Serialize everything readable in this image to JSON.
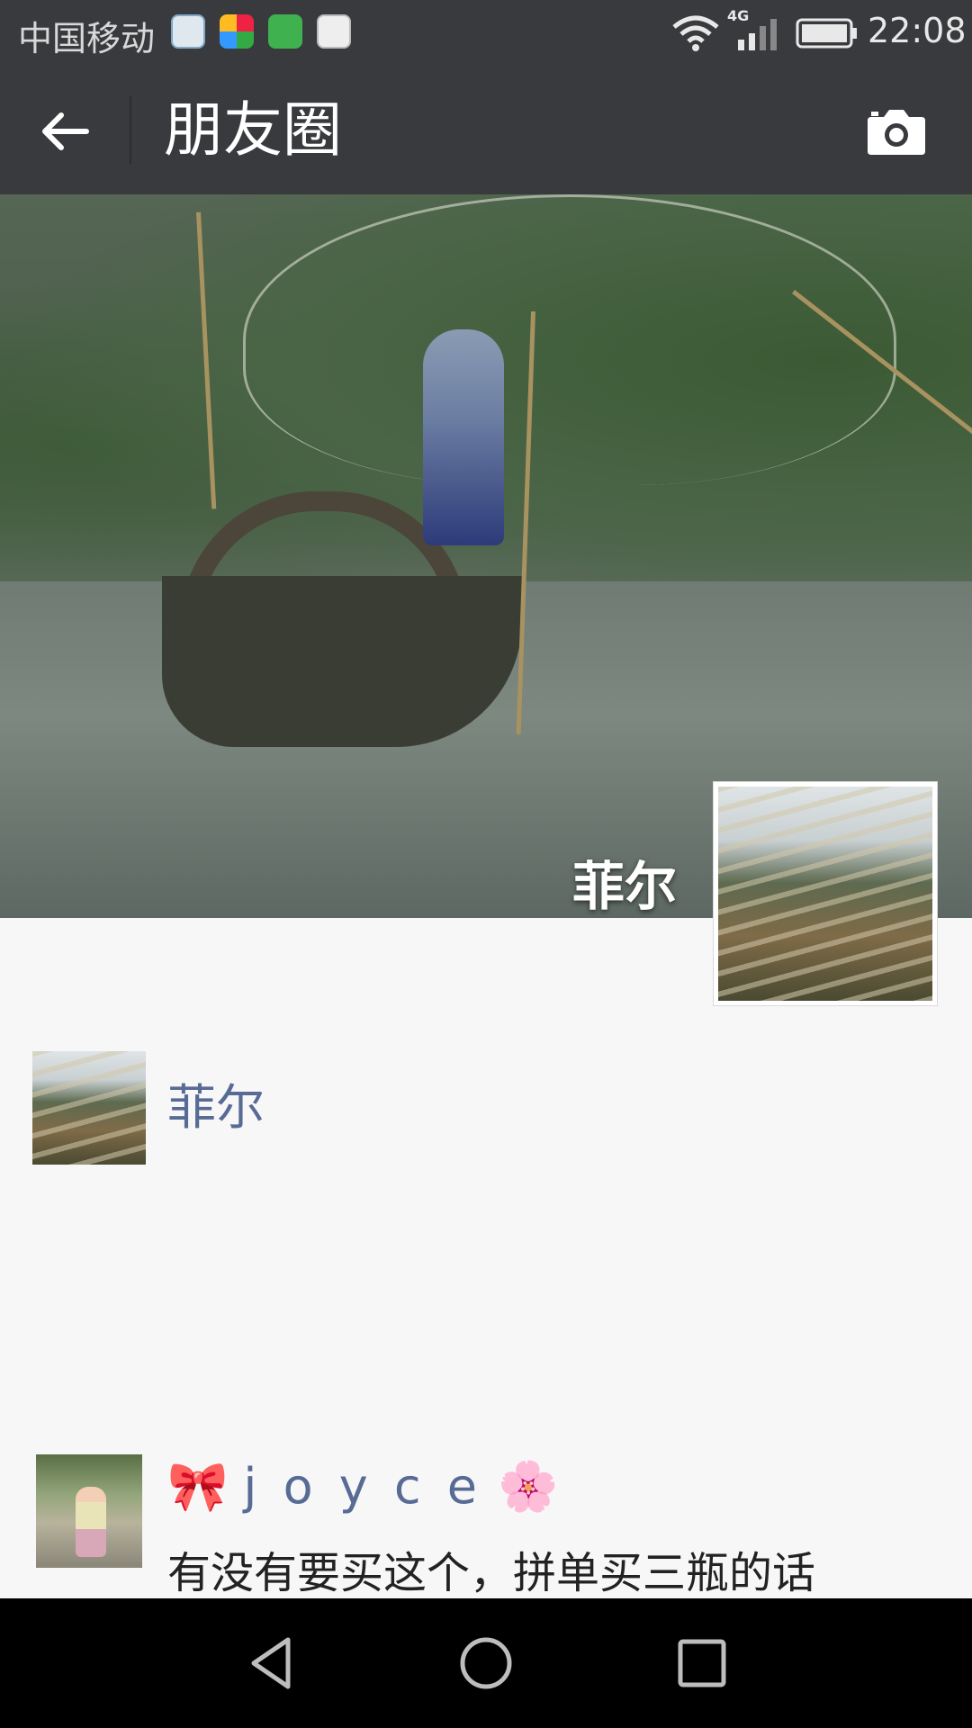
{
  "status_bar": {
    "carrier": "中国移动",
    "network": "4G",
    "time": "22:08",
    "notification_icons": [
      "browser-icon",
      "app-icon",
      "grid-app-icon",
      "map-pin-icon"
    ]
  },
  "nav": {
    "title": "朋友圈",
    "back_icon": "arrow-left-icon",
    "camera_icon": "camera-icon",
    "background_color": "#393a3e"
  },
  "profile": {
    "name": "菲尔"
  },
  "feed": [
    {
      "author": "菲尔",
      "text": ""
    },
    {
      "author_emoji_left": "🎀",
      "author": "j o y c e",
      "author_emoji_right": "🌸",
      "text": "有没有要买这个，拼单买三瓶的话"
    }
  ],
  "colors": {
    "author_link": "#576b95",
    "page_background": "#f7f7f8"
  }
}
